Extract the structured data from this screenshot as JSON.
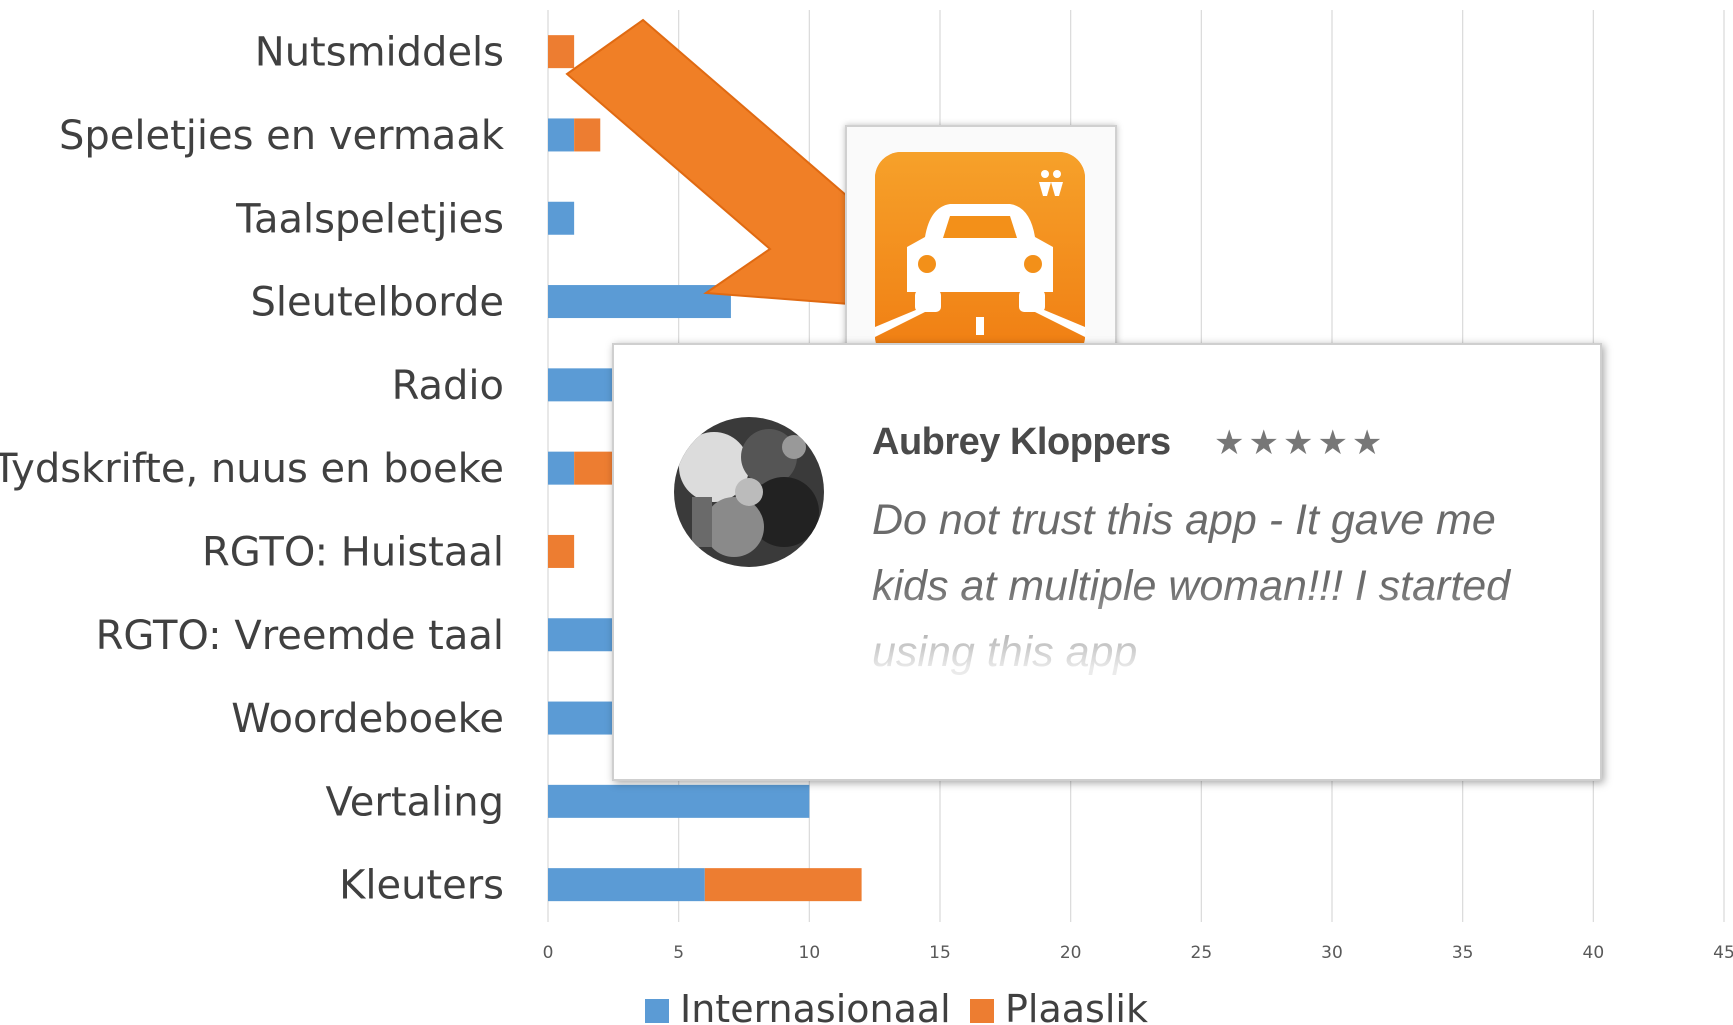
{
  "chart_data": {
    "type": "bar",
    "orientation": "horizontal",
    "stacked": true,
    "categories": [
      "Nutsmiddels",
      "Speletjies en vermaak",
      "Taalspeletjies",
      "Sleutelborde",
      "Radio",
      "Tydskrifte, nuus en boeke",
      "RGTO: Huistaal",
      "RGTO: Vreemde taal",
      "Woordeboeke",
      "Vertaling",
      "Kleuters"
    ],
    "series": [
      {
        "name": "Internasionaal",
        "color": "#5b9bd5",
        "values": [
          0,
          1,
          1,
          7,
          3,
          1,
          0,
          3,
          3,
          10,
          6
        ]
      },
      {
        "name": "Plaaslik",
        "color": "#ed7d31",
        "values": [
          1,
          1,
          0,
          0,
          0,
          2,
          1,
          0,
          0,
          0,
          6
        ]
      }
    ],
    "xlim": [
      0,
      45
    ],
    "xticks": [
      "0",
      "5",
      "10",
      "15",
      "20",
      "25",
      "30",
      "35",
      "40",
      "45"
    ],
    "grid": true,
    "legend_position": "bottom"
  },
  "overlay": {
    "arrow_color": "#f07f26",
    "app_icon": {
      "name": "car-app-icon",
      "color": "#f39019"
    },
    "review": {
      "author": "Aubrey Kloppers",
      "stars": "★★★★★",
      "text": "Do not trust this app - It gave me kids at multiple woman!!! I started using this app"
    }
  }
}
